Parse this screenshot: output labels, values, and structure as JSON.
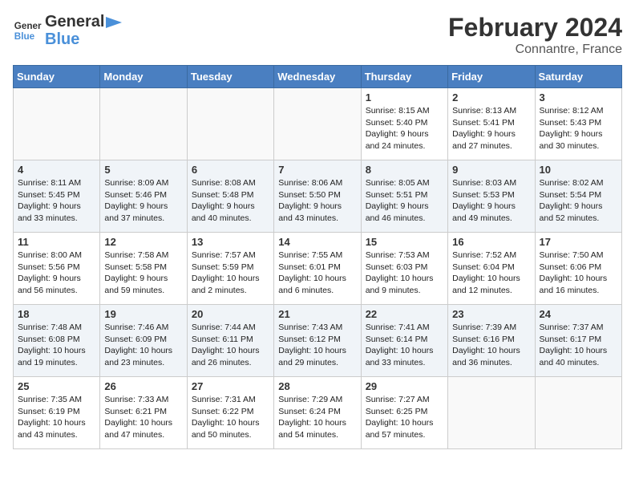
{
  "header": {
    "logo_line1": "General",
    "logo_line2": "Blue",
    "title": "February 2024",
    "subtitle": "Connantre, France"
  },
  "days_of_week": [
    "Sunday",
    "Monday",
    "Tuesday",
    "Wednesday",
    "Thursday",
    "Friday",
    "Saturday"
  ],
  "weeks": [
    [
      {
        "day": "",
        "info": ""
      },
      {
        "day": "",
        "info": ""
      },
      {
        "day": "",
        "info": ""
      },
      {
        "day": "",
        "info": ""
      },
      {
        "day": "1",
        "info": "Sunrise: 8:15 AM\nSunset: 5:40 PM\nDaylight: 9 hours\nand 24 minutes."
      },
      {
        "day": "2",
        "info": "Sunrise: 8:13 AM\nSunset: 5:41 PM\nDaylight: 9 hours\nand 27 minutes."
      },
      {
        "day": "3",
        "info": "Sunrise: 8:12 AM\nSunset: 5:43 PM\nDaylight: 9 hours\nand 30 minutes."
      }
    ],
    [
      {
        "day": "4",
        "info": "Sunrise: 8:11 AM\nSunset: 5:45 PM\nDaylight: 9 hours\nand 33 minutes."
      },
      {
        "day": "5",
        "info": "Sunrise: 8:09 AM\nSunset: 5:46 PM\nDaylight: 9 hours\nand 37 minutes."
      },
      {
        "day": "6",
        "info": "Sunrise: 8:08 AM\nSunset: 5:48 PM\nDaylight: 9 hours\nand 40 minutes."
      },
      {
        "day": "7",
        "info": "Sunrise: 8:06 AM\nSunset: 5:50 PM\nDaylight: 9 hours\nand 43 minutes."
      },
      {
        "day": "8",
        "info": "Sunrise: 8:05 AM\nSunset: 5:51 PM\nDaylight: 9 hours\nand 46 minutes."
      },
      {
        "day": "9",
        "info": "Sunrise: 8:03 AM\nSunset: 5:53 PM\nDaylight: 9 hours\nand 49 minutes."
      },
      {
        "day": "10",
        "info": "Sunrise: 8:02 AM\nSunset: 5:54 PM\nDaylight: 9 hours\nand 52 minutes."
      }
    ],
    [
      {
        "day": "11",
        "info": "Sunrise: 8:00 AM\nSunset: 5:56 PM\nDaylight: 9 hours\nand 56 minutes."
      },
      {
        "day": "12",
        "info": "Sunrise: 7:58 AM\nSunset: 5:58 PM\nDaylight: 9 hours\nand 59 minutes."
      },
      {
        "day": "13",
        "info": "Sunrise: 7:57 AM\nSunset: 5:59 PM\nDaylight: 10 hours\nand 2 minutes."
      },
      {
        "day": "14",
        "info": "Sunrise: 7:55 AM\nSunset: 6:01 PM\nDaylight: 10 hours\nand 6 minutes."
      },
      {
        "day": "15",
        "info": "Sunrise: 7:53 AM\nSunset: 6:03 PM\nDaylight: 10 hours\nand 9 minutes."
      },
      {
        "day": "16",
        "info": "Sunrise: 7:52 AM\nSunset: 6:04 PM\nDaylight: 10 hours\nand 12 minutes."
      },
      {
        "day": "17",
        "info": "Sunrise: 7:50 AM\nSunset: 6:06 PM\nDaylight: 10 hours\nand 16 minutes."
      }
    ],
    [
      {
        "day": "18",
        "info": "Sunrise: 7:48 AM\nSunset: 6:08 PM\nDaylight: 10 hours\nand 19 minutes."
      },
      {
        "day": "19",
        "info": "Sunrise: 7:46 AM\nSunset: 6:09 PM\nDaylight: 10 hours\nand 23 minutes."
      },
      {
        "day": "20",
        "info": "Sunrise: 7:44 AM\nSunset: 6:11 PM\nDaylight: 10 hours\nand 26 minutes."
      },
      {
        "day": "21",
        "info": "Sunrise: 7:43 AM\nSunset: 6:12 PM\nDaylight: 10 hours\nand 29 minutes."
      },
      {
        "day": "22",
        "info": "Sunrise: 7:41 AM\nSunset: 6:14 PM\nDaylight: 10 hours\nand 33 minutes."
      },
      {
        "day": "23",
        "info": "Sunrise: 7:39 AM\nSunset: 6:16 PM\nDaylight: 10 hours\nand 36 minutes."
      },
      {
        "day": "24",
        "info": "Sunrise: 7:37 AM\nSunset: 6:17 PM\nDaylight: 10 hours\nand 40 minutes."
      }
    ],
    [
      {
        "day": "25",
        "info": "Sunrise: 7:35 AM\nSunset: 6:19 PM\nDaylight: 10 hours\nand 43 minutes."
      },
      {
        "day": "26",
        "info": "Sunrise: 7:33 AM\nSunset: 6:21 PM\nDaylight: 10 hours\nand 47 minutes."
      },
      {
        "day": "27",
        "info": "Sunrise: 7:31 AM\nSunset: 6:22 PM\nDaylight: 10 hours\nand 50 minutes."
      },
      {
        "day": "28",
        "info": "Sunrise: 7:29 AM\nSunset: 6:24 PM\nDaylight: 10 hours\nand 54 minutes."
      },
      {
        "day": "29",
        "info": "Sunrise: 7:27 AM\nSunset: 6:25 PM\nDaylight: 10 hours\nand 57 minutes."
      },
      {
        "day": "",
        "info": ""
      },
      {
        "day": "",
        "info": ""
      }
    ]
  ]
}
